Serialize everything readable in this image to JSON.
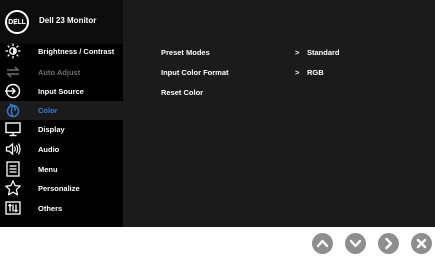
{
  "osd": {
    "title": "Dell 23 Monitor",
    "logo_text": "DɆLL",
    "menu": [
      {
        "label": "Brightness / Contrast",
        "icon": "brightness-icon",
        "state": "normal"
      },
      {
        "label": "Auto Adjust",
        "icon": "auto-adjust-icon",
        "state": "disabled"
      },
      {
        "label": "Input Source",
        "icon": "input-source-icon",
        "state": "normal"
      },
      {
        "label": "Color",
        "icon": "color-icon",
        "state": "active"
      },
      {
        "label": "Display",
        "icon": "display-icon",
        "state": "normal"
      },
      {
        "label": "Audio",
        "icon": "audio-icon",
        "state": "normal"
      },
      {
        "label": "Menu",
        "icon": "menu-icon",
        "state": "normal"
      },
      {
        "label": "Personalize",
        "icon": "star-icon",
        "state": "normal"
      },
      {
        "label": "Others",
        "icon": "others-icon",
        "state": "normal"
      }
    ],
    "settings": [
      {
        "label": "Preset Modes",
        "value": "Standard"
      },
      {
        "label": "Input Color Format",
        "value": "RGB"
      },
      {
        "label": "Reset Color",
        "value": ""
      }
    ],
    "value_chevron": ">"
  },
  "buttons": [
    "up-button",
    "down-button",
    "right-button",
    "close-button"
  ],
  "colors": {
    "menu_bg": "#000000",
    "content_bg": "#1b1b1b",
    "active": "#3b7bd4",
    "disabled": "#6f6f6f",
    "button": "#8e8e8e"
  }
}
